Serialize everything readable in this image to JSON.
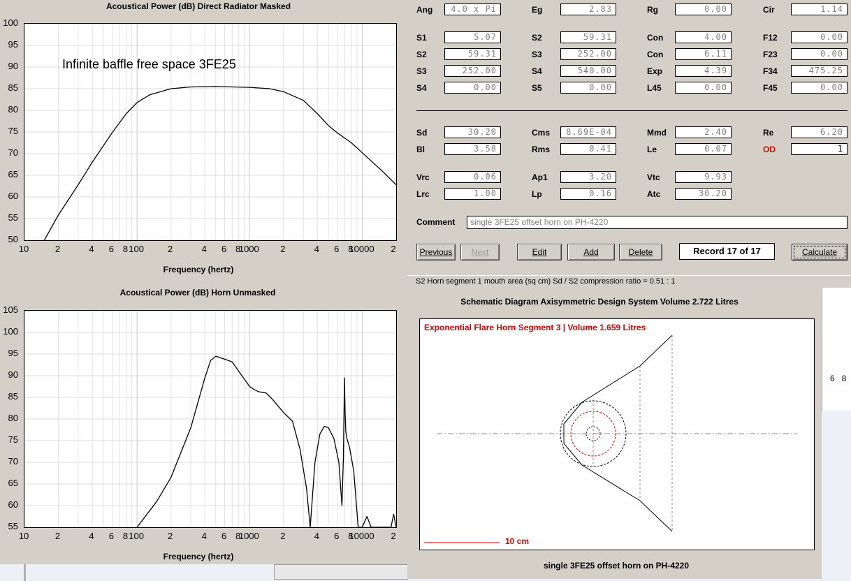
{
  "top_chart": {
    "title": "Acoustical Power (dB)   Direct Radiator   Masked",
    "annotation": "Infinite baffle free space 3FE25",
    "x_axis_label": "Frequency (hertz)",
    "y_ticks": [
      "100",
      "95",
      "90",
      "85",
      "80",
      "75",
      "70",
      "65",
      "60",
      "55",
      "50"
    ],
    "x_ticks": [
      "10",
      "2",
      "4",
      "6",
      "8",
      "100",
      "2",
      "4",
      "6",
      "8",
      "1000",
      "2",
      "4",
      "6",
      "8",
      "10000",
      "2"
    ]
  },
  "bottom_chart": {
    "title": "Acoustical Power (dB)   Horn   Unmasked",
    "x_axis_label": "Frequency (hertz)",
    "y_ticks": [
      "105",
      "100",
      "95",
      "90",
      "85",
      "80",
      "75",
      "70",
      "65",
      "60",
      "55"
    ],
    "x_ticks": [
      "10",
      "2",
      "4",
      "6",
      "8",
      "100",
      "2",
      "4",
      "6",
      "8",
      "1000",
      "2",
      "4",
      "6",
      "8",
      "10000",
      "2"
    ]
  },
  "chart_data": [
    {
      "type": "line",
      "title": "Acoustical Power (dB)   Direct Radiator   Masked",
      "xlabel": "Frequency (hertz)",
      "ylabel": "",
      "xscale": "log",
      "xlim": [
        10,
        20000
      ],
      "ylim": [
        50,
        100
      ],
      "grid": true,
      "annotation": "Infinite baffle free space 3FE25",
      "series": [
        {
          "x": [
            15,
            20,
            30,
            40,
            60,
            80,
            100,
            130,
            200,
            300,
            500,
            1000,
            1500,
            2000,
            3000,
            4000,
            5000,
            6000,
            8000,
            10000,
            15000,
            20000
          ],
          "y": [
            50,
            55.8,
            62.8,
            68,
            74.8,
            79.2,
            81.8,
            83.6,
            85.0,
            85.4,
            85.5,
            85.3,
            85.0,
            84.3,
            82.3,
            79.2,
            76.5,
            74.8,
            72.5,
            70.2,
            66.0,
            62.8
          ]
        }
      ]
    },
    {
      "type": "line",
      "title": "Acoustical Power (dB)   Horn   Unmasked",
      "xlabel": "Frequency (hertz)",
      "ylabel": "",
      "xscale": "log",
      "xlim": [
        10,
        20000
      ],
      "ylim": [
        55,
        105
      ],
      "grid": true,
      "series": [
        {
          "x": [
            100,
            150,
            200,
            300,
            400,
            450,
            500,
            600,
            700,
            800,
            1000,
            1100,
            1200,
            1400,
            1600,
            2000,
            2400,
            2800,
            3200,
            3450,
            3800,
            4200,
            4600,
            5000,
            5600,
            6200,
            6600,
            6800,
            6950,
            7050,
            7150,
            7300,
            7700,
            8400,
            9200,
            10000,
            11000,
            12000,
            14000,
            16000,
            18000,
            19000,
            20000
          ],
          "y": [
            55,
            61,
            66.5,
            78,
            89.5,
            93.5,
            94.5,
            93.8,
            93.2,
            91,
            87.5,
            86.8,
            86.3,
            86.0,
            84.5,
            81.5,
            79.5,
            73,
            64,
            55,
            70,
            76.5,
            78.3,
            78.0,
            75.5,
            70.0,
            60.0,
            71,
            89.5,
            81,
            77,
            75.5,
            73.5,
            68,
            55,
            55,
            57.5,
            55,
            55,
            55,
            55,
            58,
            55
          ]
        }
      ]
    }
  ],
  "params": {
    "row1": [
      {
        "label": "Ang",
        "value": "4.0 x Pi"
      },
      {
        "label": "Eg",
        "value": "2.83"
      },
      {
        "label": "Rg",
        "value": "0.00"
      },
      {
        "label": "Cir",
        "value": "1.14"
      }
    ],
    "row2": [
      {
        "label": "S1",
        "value": "5.07"
      },
      {
        "label": "S2",
        "value": "59.31"
      },
      {
        "label": "Con",
        "value": "4.00"
      },
      {
        "label": "F12",
        "value": "0.00"
      }
    ],
    "row3": [
      {
        "label": "S2",
        "value": "59.31"
      },
      {
        "label": "S3",
        "value": "252.00"
      },
      {
        "label": "Con",
        "value": "6.11"
      },
      {
        "label": "F23",
        "value": "0.00"
      }
    ],
    "row4": [
      {
        "label": "S3",
        "value": "252.00"
      },
      {
        "label": "S4",
        "value": "540.00"
      },
      {
        "label": "Exp",
        "value": "4.39"
      },
      {
        "label": "F34",
        "value": "475.25"
      }
    ],
    "row5": [
      {
        "label": "S4",
        "value": "0.00"
      },
      {
        "label": "S5",
        "value": "0.00"
      },
      {
        "label": "L45",
        "value": "0.00"
      },
      {
        "label": "F45",
        "value": "0.00"
      }
    ],
    "row6": [
      {
        "label": "Sd",
        "value": "30.20"
      },
      {
        "label": "Cms",
        "value": "8.69E-04"
      },
      {
        "label": "Mmd",
        "value": "2.40"
      },
      {
        "label": "Re",
        "value": "6.20"
      }
    ],
    "row7": [
      {
        "label": "Bl",
        "value": "3.58"
      },
      {
        "label": "Rms",
        "value": "0.41"
      },
      {
        "label": "Le",
        "value": "0.07"
      },
      {
        "label": "OD",
        "value": "1"
      }
    ],
    "row8": [
      {
        "label": "Vrc",
        "value": "0.06"
      },
      {
        "label": "Ap1",
        "value": "3.20"
      },
      {
        "label": "Vtc",
        "value": "9.93"
      }
    ],
    "row9": [
      {
        "label": "Lrc",
        "value": "1.00"
      },
      {
        "label": "Lp",
        "value": "0.16"
      },
      {
        "label": "Atc",
        "value": "30.20"
      }
    ]
  },
  "comment": {
    "label": "Comment",
    "value": "single 3FE25 offset horn on PH-4220"
  },
  "buttons": {
    "previous": "Previous",
    "next": "Next",
    "edit": "Edit",
    "add": "Add",
    "delete": "Delete",
    "record": "Record 17 of 17",
    "calculate": "Calculate"
  },
  "status": "S2   Horn segment 1 mouth area  (sq cm)   Sd / S2 compression ratio = 0.51 : 1",
  "schematic": {
    "title": "Schematic Diagram   Axisymmetric Design   System Volume 2.722 Litres",
    "segment_label": "Exponential Flare Horn Segment 3 | Volume 1.659 Litres",
    "scale_label": "10 cm",
    "caption": "single 3FE25 offset horn on PH-4220"
  },
  "background_fragment": {
    "ticks": "6   8"
  },
  "colors": {
    "od_label": "#e00000",
    "schematic_red": "#d00000",
    "window_bg": "#d4d0c8"
  }
}
